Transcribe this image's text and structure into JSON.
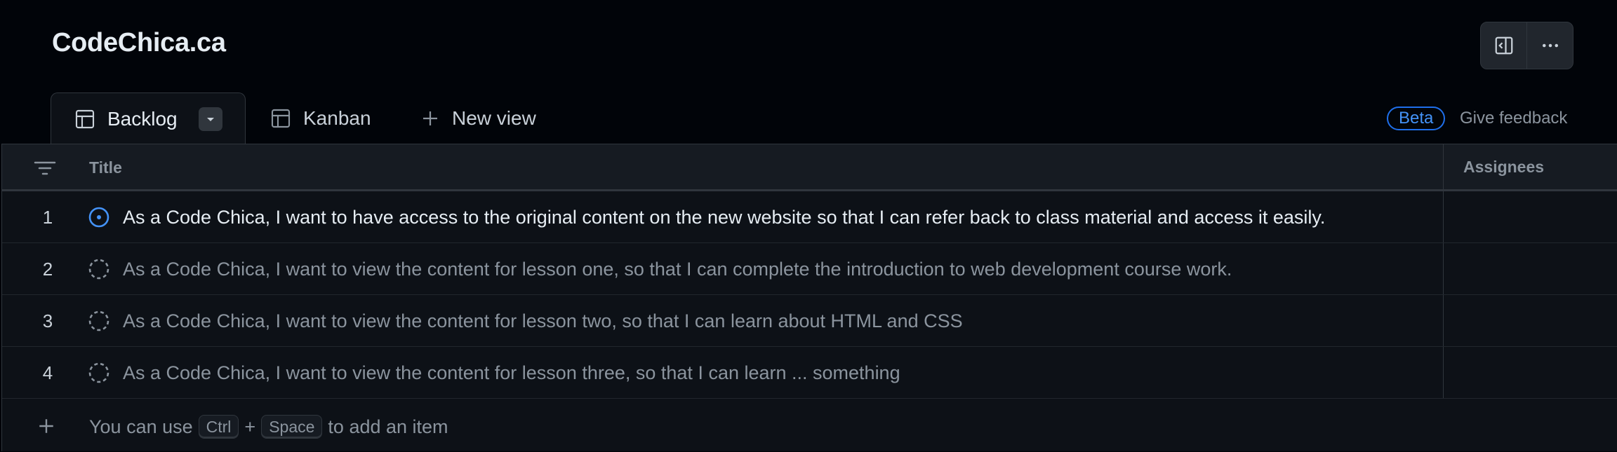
{
  "project": {
    "title": "CodeChica.ca"
  },
  "top_actions": {
    "panel_icon": "sidebar-panel-icon",
    "more_icon": "kebab-horizontal-icon"
  },
  "tabs": [
    {
      "label": "Backlog",
      "icon": "table-icon",
      "active": true
    },
    {
      "label": "Kanban",
      "icon": "table-icon",
      "active": false
    },
    {
      "label": "New view",
      "icon": "plus-icon",
      "active": false
    }
  ],
  "beta": {
    "badge": "Beta",
    "feedback": "Give feedback"
  },
  "table": {
    "columns": [
      "Title",
      "Assignees"
    ],
    "rows": [
      {
        "num": "1",
        "status": "open",
        "title": "As a Code Chica, I want to have access to the original content on the new website so that I can refer back to class material and access it easily."
      },
      {
        "num": "2",
        "status": "draft",
        "title": "As a Code Chica, I want to view the content for lesson one, so that I can complete the introduction to web development course work."
      },
      {
        "num": "3",
        "status": "draft",
        "title": "As a Code Chica, I want to view the content for lesson two, so that I can learn about HTML and CSS"
      },
      {
        "num": "4",
        "status": "draft",
        "title": "As a Code Chica, I want to view the content for lesson three, so that I can learn ... something"
      }
    ],
    "add_item": {
      "prefix": "You can use",
      "key1": "Ctrl",
      "plus": "+",
      "key2": "Space",
      "suffix": "to add an item"
    }
  },
  "colors": {
    "accent": "#4493f8",
    "background": "#010409",
    "table_bg": "#0d1117"
  }
}
